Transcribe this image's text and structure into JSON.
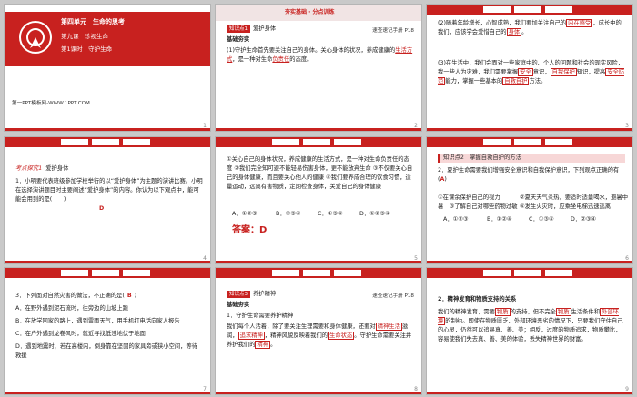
{
  "slides": {
    "s1": {
      "num": "1",
      "unit": "第四单元　生命的思考",
      "lesson": "第九课　珍视生命",
      "period": "第1课时　守护生命",
      "footer": "第一PPT模板网-WWW.1PPT.COM"
    },
    "s2": {
      "num": "2",
      "banner": "夯实基础 · 分点训练",
      "tag": "知识点1",
      "title": "爱护身体",
      "ref": "速查速记手册 P18",
      "sub": "基础夯实",
      "body_pre": "(1)守护生命首先要关注自己的身体。关心身体的状况，养成健康的",
      "fill1": "生活方式",
      "body_mid": "，是一种对生命",
      "fill2": "负责任",
      "body_post": "的态度。"
    },
    "s3": {
      "num": "3",
      "p1_pre": "(2)随着年龄增长，心智成熟，我们要加关注自己的",
      "p1_f1": "内在感受",
      "p1_mid": "，成长中的我们，应该学会爱惜自己的",
      "p1_f2": "身体",
      "p1_post": "。",
      "p2_pre": "(3)在生活中，我们会面对一些家庭中的、个人的问题和社会的现实风险，我一些人为灾难，我们需要掌握",
      "p2_f1": "安全",
      "p2_mid": "意识，",
      "p2_f2": "自我保护",
      "p2_mid2": "知识，提高",
      "p2_f3": "安全防范",
      "p2_post": "能力，掌握一些基本的",
      "p2_f4": "自救自护",
      "p2_end": "方法。"
    },
    "s4": {
      "num": "4",
      "tag": "考点探究1",
      "title": "爱护身体",
      "q": "1．小明要代表班级参加学校举行的以“爱护身体”为主题的演讲比赛。小明在选择演讲题目时主要阐述“爱护身体”的内容。你认为以下观点中，能可能会用到的是(　　)",
      "ans": "D"
    },
    "s5": {
      "num": "5",
      "q": "①关心自己的身体状况，养成健康的生活方式，是一种对生命负责任的态度 ②我们完全知可避不能轻易伤害身体，更不能放弃生命 ③不仅要关心自己的身体健康，而且要关心他人的健康 ④我们要养成合理的饮食习惯，适量运动，远离有害物质，定期检查身体，关爱自己的身体健康",
      "opt_a": "A．①②③",
      "opt_b": "B．②③④",
      "opt_c": "C．①③④",
      "opt_d": "D．①②③④",
      "answer": "答案：D"
    },
    "s6": {
      "num": "6",
      "sec": "知识点2　掌握自救自护的方法",
      "q": "2．夏护生命需要我们增强安全意识和自我保护意识，下列观点正确的有(",
      "q_ans": "A",
      "q_end": ")",
      "o1": "①在课余保护自己的视力",
      "o2": "②夏天天气炎热，要适时适量喝水，避暑中",
      "o3": "暑　③了解自己对哪些药物过敏",
      "o4": "④发生火灾时，应乘坐电梯迅速逃离",
      "opt_a": "A．①②③",
      "opt_b": "B．①②④",
      "opt_c": "C．①③④",
      "opt_d": "D．②③④"
    },
    "s7": {
      "num": "7",
      "q_pre": "3．下列面对自然灾害的做法，不正确的是(",
      "q_ans": "B",
      "q_end": ")",
      "a": "A．在野外遇到泥石流时，往旁边的山坡上跑",
      "b": "B．在放学回家的路上，遇到雷雨天气，用手机打电话向家人报告",
      "c": "C．在户外遇到龙卷风时，就近寻找低洼地伏于地面",
      "d": "D．遇到地震时，若在高楼内，倒身靠在坚固的家具旁或狭小空间，等待救援"
    },
    "s8": {
      "num": "8",
      "tag": "知识点3",
      "title": "养护精神",
      "ref": "速查速记手册 P18",
      "sub": "基础夯实",
      "p1": "1．守护生命需要养护精神",
      "p2_pre": "我们每个人活着，除了要关注生理需要和身体健康，还要对",
      "p2_f1": "精神生活",
      "p2_mid": "滋润，",
      "p2_f2": "追求精神",
      "p2_mid2": "，精神风貌反映着我们的",
      "p2_f3": "生命状态",
      "p2_mid3": "。守护生命需要关注并养护我们的",
      "p2_f4": "精神",
      "p2_end": "。"
    },
    "s9": {
      "num": "9",
      "p1": "2．精神发育和物质支持的关系",
      "p2_pre": "我们的精神发育，需要",
      "p2_f1": "物质",
      "p2_mid": "的支持，但不完全",
      "p2_f2": "物质",
      "p2_mid2": "生活条件和",
      "p2_f3": "外部环境",
      "p2_post": "的制约。即使在物质匮乏、外部环境恶劣的情况下，只要我们守住自己的心灵，仍然可以追寻真、善、美；相反，过度的物质追求，物质攀比，容易使我们失去真、善、美的体验，丢失精神世界的财富。"
    }
  },
  "colors": {
    "accent": "#c8211f",
    "highlight_bg": "#f7d7d7"
  }
}
